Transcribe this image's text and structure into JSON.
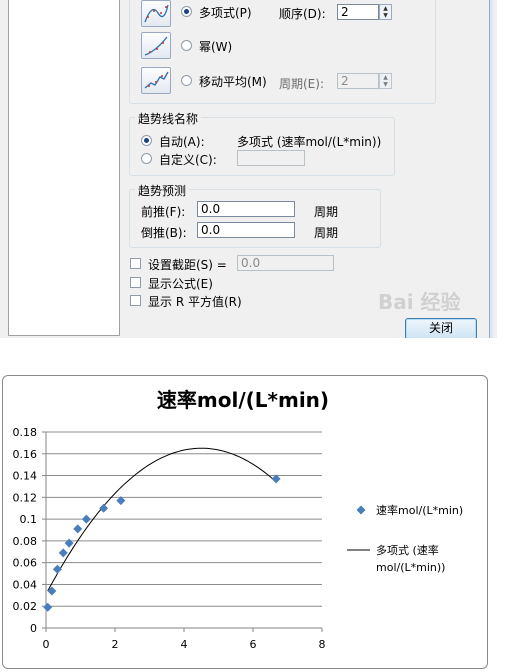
{
  "dialog": {
    "types": [
      {
        "label": "多项式(P)",
        "selected": true
      },
      {
        "label": "幂(W)",
        "selected": false
      },
      {
        "label": "移动平均(M)",
        "selected": false
      }
    ],
    "order_label": "顺序(D):",
    "order_value": "2",
    "period_label": "周期(E):",
    "period_value": "2",
    "trendline_name_title": "趋势线名称",
    "auto_label": "自动(A):",
    "auto_value": "多项式 (速率mol/(L*min))",
    "custom_label": "自定义(C):",
    "forecast_title": "趋势预测",
    "forward_label": "前推(F):",
    "forward_value": "0.0",
    "backward_label": "倒推(B):",
    "backward_value": "0.0",
    "period_unit": "周期",
    "intercept_label": "设置截距(S) =",
    "intercept_value": "0.0",
    "show_equation_label": "显示公式(E)",
    "show_r2_label": "显示 R 平方值(R)",
    "close_label": "关闭",
    "watermark": "Bai 经验"
  },
  "chart_data": {
    "type": "scatter",
    "title": "速率mol/(L*min)",
    "xlim": [
      0,
      8
    ],
    "ylim": [
      0,
      0.18
    ],
    "x_ticks": [
      "0",
      "2",
      "4",
      "6",
      "8"
    ],
    "y_ticks": [
      "0",
      "0.02",
      "0.04",
      "0.06",
      "0.08",
      "0.1",
      "0.12",
      "0.14",
      "0.16",
      "0.18"
    ],
    "grid": "horizontal",
    "legend_position": "right",
    "series": [
      {
        "name": "速率mol/(L*min)",
        "marker": "diamond",
        "color": "#4a7ebb",
        "points": [
          [
            0.05,
            0.019
          ],
          [
            0.17,
            0.034
          ],
          [
            0.33,
            0.054
          ],
          [
            0.5,
            0.069
          ],
          [
            0.67,
            0.078
          ],
          [
            0.92,
            0.091
          ],
          [
            1.17,
            0.1
          ],
          [
            1.67,
            0.11
          ],
          [
            2.17,
            0.117
          ],
          [
            6.67,
            0.137
          ]
        ]
      }
    ],
    "trendline": {
      "name": "多项式 (速率mol/(L*min))",
      "legend_lines": [
        "多项式 (速率",
        "mol/(L*min))"
      ],
      "type": "polynomial",
      "order": 2,
      "color": "#000000",
      "coefficients": [
        0.031,
        0.0595,
        -0.0066
      ]
    }
  }
}
